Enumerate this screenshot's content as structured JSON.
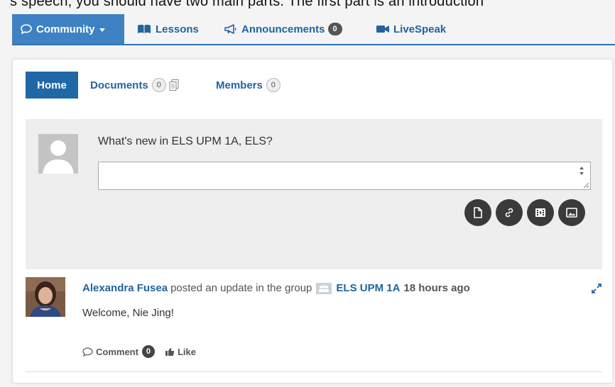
{
  "top_clipped_text": "s speech, you should have two main parts. The first part is an introduction",
  "topnav": {
    "community": "Community",
    "lessons": "Lessons",
    "announcements": "Announcements",
    "announcements_count": "0",
    "livespeak": "LiveSpeak"
  },
  "subtabs": {
    "home": "Home",
    "documents": "Documents",
    "documents_count": "0",
    "members": "Members",
    "members_count": "0"
  },
  "postform": {
    "prompt": "What's new in ELS UPM 1A, ELS?",
    "value": "",
    "tools": [
      "file-icon",
      "link-icon",
      "video-icon",
      "image-icon"
    ]
  },
  "activity": {
    "author": "Alexandra Fusea",
    "action": "posted an update in the group",
    "group": "ELS UPM 1A",
    "time": "18 hours ago",
    "content": "Welcome, Nie Jing!",
    "comment_label": "Comment",
    "comment_count": "0",
    "like_label": "Like"
  },
  "colors": {
    "accent": "#3e82c4",
    "link": "#2263a0",
    "home_tab": "#1f67a6"
  }
}
